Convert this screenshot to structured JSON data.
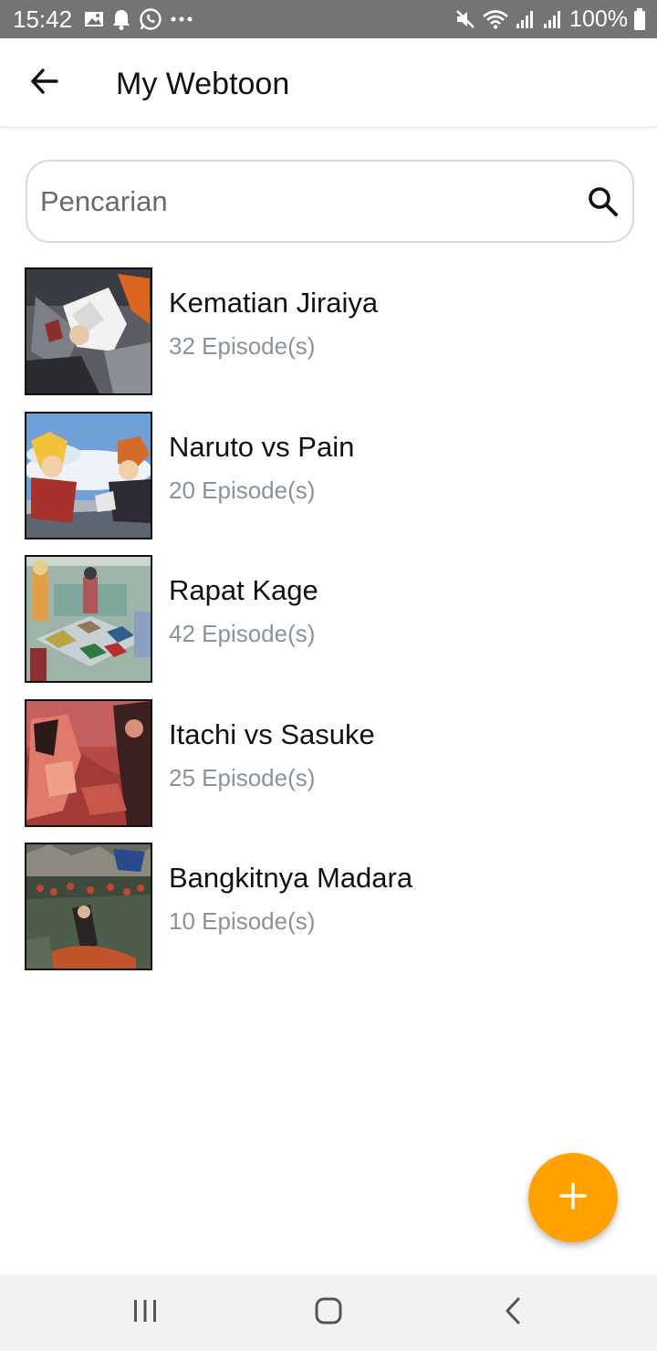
{
  "status_bar": {
    "time": "15:42",
    "battery": "100%",
    "left_icons": [
      "image-icon",
      "bell-icon",
      "whatsapp-icon",
      "more-dots-icon"
    ],
    "right_icons": [
      "mute-icon",
      "wifi-icon",
      "signal-icon",
      "signal-icon",
      "battery-icon"
    ]
  },
  "app_bar": {
    "title": "My Webtoon",
    "back_icon": "arrow-left-icon"
  },
  "search": {
    "placeholder": "Pencarian",
    "value": "",
    "icon": "search-icon"
  },
  "webtoons": [
    {
      "title": "Kematian Jiraiya",
      "episodes": "32 Episode(s)"
    },
    {
      "title": "Naruto vs Pain",
      "episodes": "20 Episode(s)"
    },
    {
      "title": "Rapat Kage",
      "episodes": "42 Episode(s)"
    },
    {
      "title": "Itachi vs Sasuke",
      "episodes": "25 Episode(s)"
    },
    {
      "title": "Bangkitnya Madara",
      "episodes": "10 Episode(s)"
    }
  ],
  "fab": {
    "icon": "plus-icon"
  },
  "nav_bar": {
    "buttons": [
      "recent-apps-icon",
      "home-icon",
      "back-icon"
    ]
  },
  "colors": {
    "status_bar": "#747474",
    "accent": "#ffa200",
    "secondary_text": "#8a9399",
    "nav_bar": "#f2f2f2"
  }
}
